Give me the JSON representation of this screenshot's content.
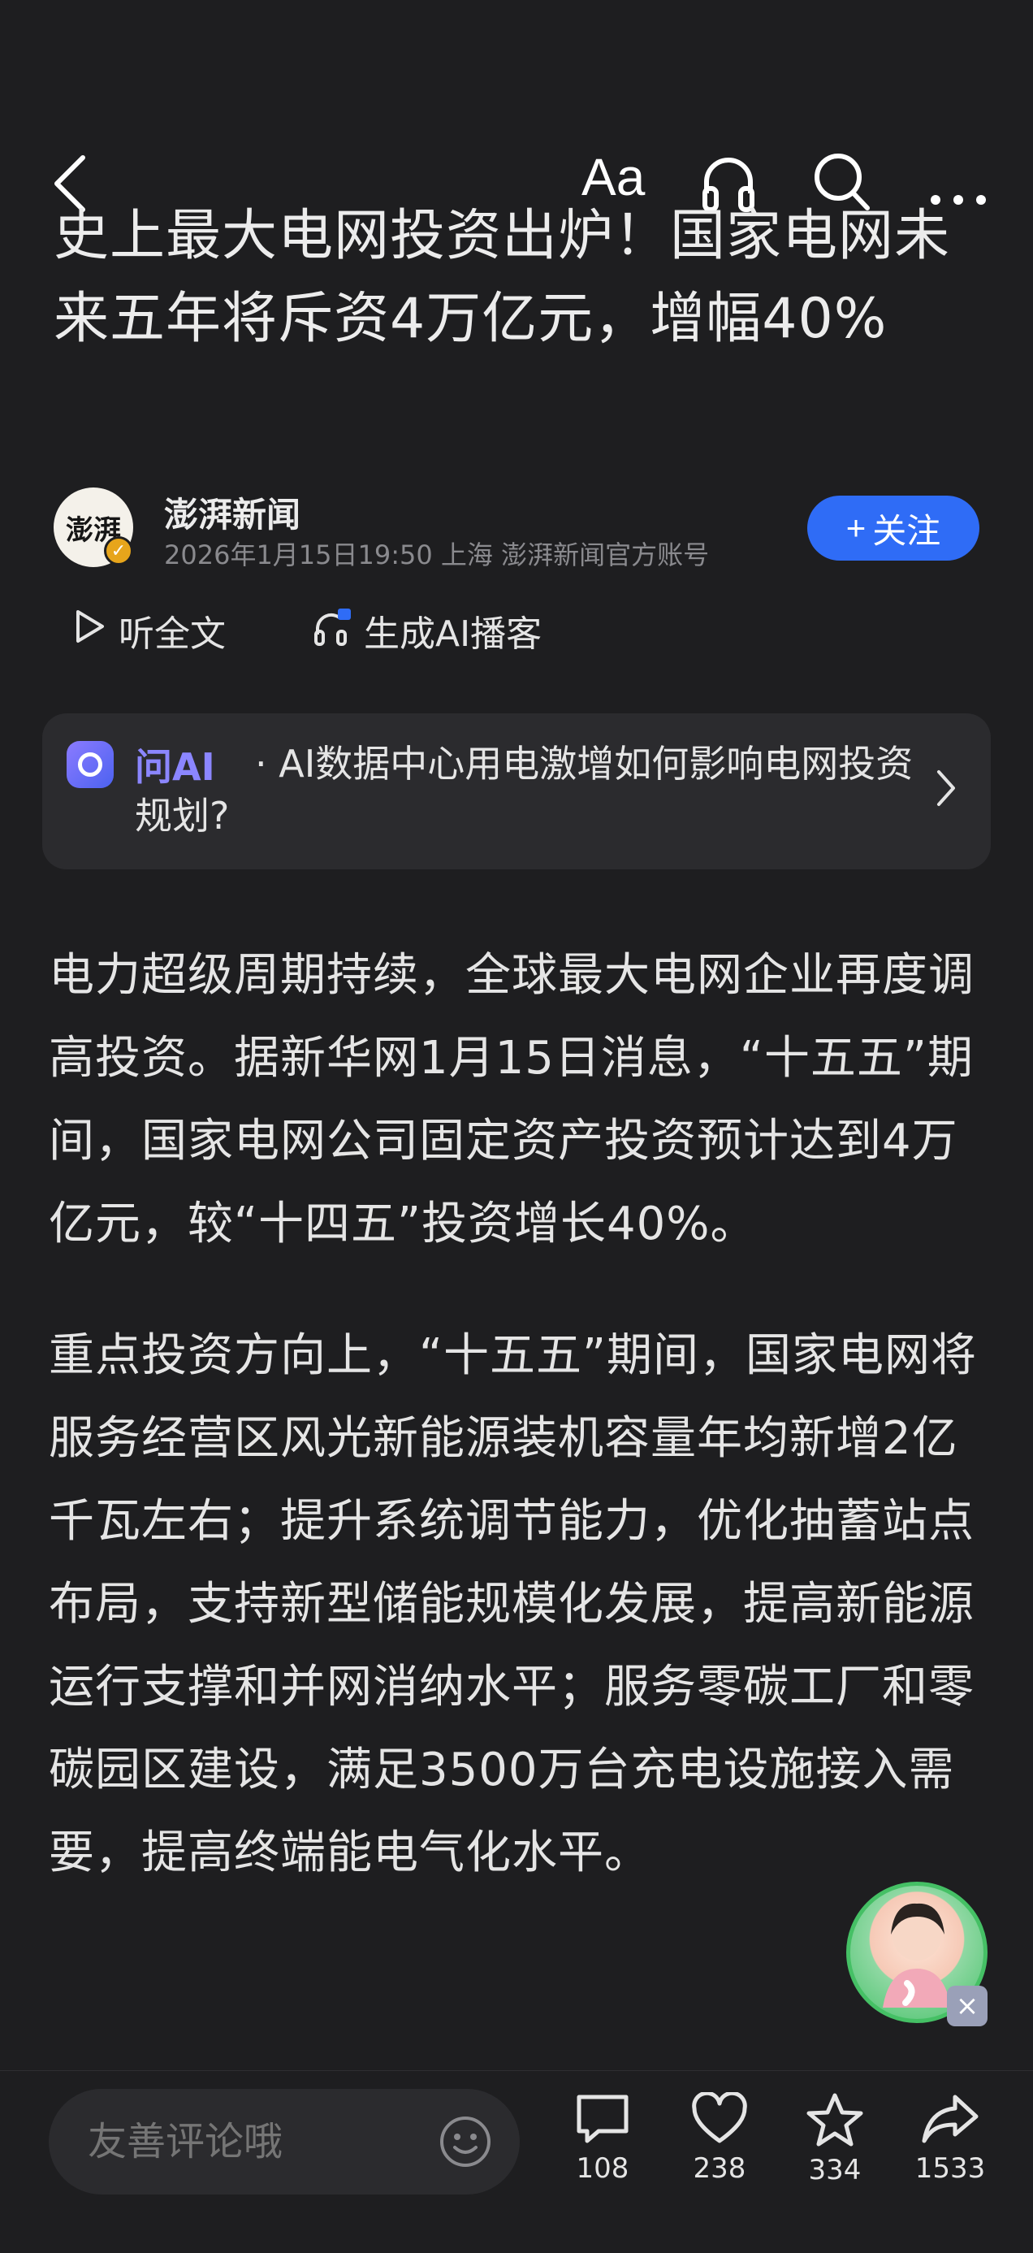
{
  "header": {
    "font_button_label": "Aa"
  },
  "article": {
    "title": "史上最大电网投资出炉！国家电网未来五年将斥资4万亿元，增幅40%",
    "author": {
      "avatar_text": "澎湃",
      "name": "澎湃新闻",
      "meta": "2026年1月15日19:50 上海 澎湃新闻官方账号"
    },
    "follow_label": "关注",
    "actions": {
      "listen_label": "听全文",
      "podcast_label": "生成AI播客"
    },
    "ai_card": {
      "label": "问AI",
      "question": "· AI数据中心用电激增如何影响电网投资规划?"
    },
    "paragraphs": [
      "电力超级周期持续，全球最大电网企业再度调高投资。据新华网1月15日消息，“十五五”期间，国家电网公司固定资产投资预计达到4万亿元，较“十四五”投资增长40%。",
      "重点投资方向上，“十五五”期间，国家电网将服务经营区风光新能源装机容量年均新增2亿千瓦左右；提升系统调节能力，优化抽蓄站点布局，支持新型储能规模化发展，提高新能源运行支撑和并网消纳水平；服务零碳工厂和零碳园区建设，满足3500万台充电设施接入需要，提高终端能电气化水平。"
    ]
  },
  "bottom_bar": {
    "comment_placeholder": "友善评论哦",
    "stats": {
      "comments": "108",
      "likes": "238",
      "favorites": "334",
      "shares": "1533"
    }
  },
  "colors": {
    "background": "#1e1e20",
    "accent_blue": "#2f6cf6",
    "ai_purple": "#8b86ff"
  }
}
